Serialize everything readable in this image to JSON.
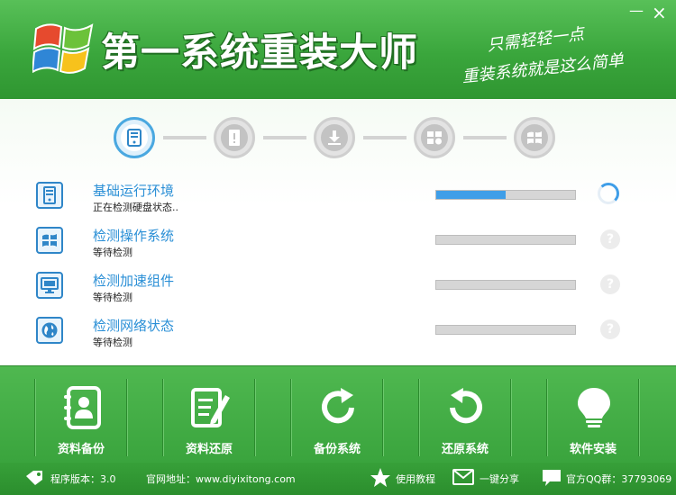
{
  "header": {
    "title": "第一系统重装大师",
    "slogan_line1": "只需轻轻一点",
    "slogan_line2": "重装系统就是这么简单",
    "minimize": "—",
    "close": "×"
  },
  "steps": [
    {
      "icon": "computer-icon",
      "state": "active"
    },
    {
      "icon": "document-alert-icon",
      "state": "pending"
    },
    {
      "icon": "download-icon",
      "state": "pending"
    },
    {
      "icon": "windows-gear-icon",
      "state": "pending"
    },
    {
      "icon": "windows-flag-icon",
      "state": "pending"
    }
  ],
  "tasks": [
    {
      "title": "基础运行环境",
      "status": "正在检测硬盘状态..",
      "progress": 0.5,
      "indicator": "spinner",
      "icon": "computer-icon"
    },
    {
      "title": "检测操作系统",
      "status": "等待检测",
      "progress": 0,
      "indicator": "question",
      "icon": "windows-icon"
    },
    {
      "title": "检测加速组件",
      "status": "等待检测",
      "progress": 0,
      "indicator": "question",
      "icon": "monitor-icon"
    },
    {
      "title": "检测网络状态",
      "status": "等待检测",
      "progress": 0,
      "indicator": "question",
      "icon": "globe-icon"
    }
  ],
  "question_mark": "?",
  "toolbar": [
    {
      "label": "资料备份",
      "icon": "address-book-icon"
    },
    {
      "label": "资料还原",
      "icon": "edit-document-icon"
    },
    {
      "label": "备份系统",
      "icon": "refresh-icon"
    },
    {
      "label": "还原系统",
      "icon": "restore-icon"
    },
    {
      "label": "软件安装",
      "icon": "lightbulb-icon"
    }
  ],
  "statusbar": {
    "version": "程序版本：3.0",
    "website": "官网地址：www.diyixitong.com",
    "tutorial": "使用教程",
    "share": "一键分享",
    "qq_group": "官方QQ群：37793069"
  },
  "colors": {
    "brand_green": "#3aa63c",
    "accent_blue": "#2a8fd6",
    "progress_blue": "#3f9ee8"
  }
}
